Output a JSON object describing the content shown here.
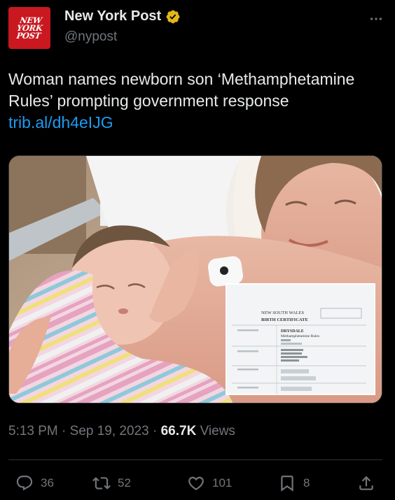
{
  "account": {
    "display_name": "New York Post",
    "handle": "@nypost",
    "logo_text": "NEW YORK POST",
    "verified_icon": "gold-verified-badge",
    "more_icon": "more-options-icon"
  },
  "tweet": {
    "text": "Woman names newborn son ‘Methamphetamine Rules’ prompting government response ",
    "link": "trib.al/dh4eIJG"
  },
  "media": {
    "certificate": {
      "state": "NEW SOUTH WALES",
      "title": "BIRTH CERTIFICATE",
      "surname": "DRYSDALE",
      "given_names": "Methamphetamine Rules"
    }
  },
  "meta": {
    "time": "5:13 PM",
    "separator": " · ",
    "date": "Sep 19, 2023",
    "views_count": "66.7K",
    "views_label": " Views"
  },
  "actions": {
    "replies": "36",
    "reposts": "52",
    "likes": "101",
    "bookmarks": "8"
  },
  "colors": {
    "background": "#000000",
    "text": "#e7e9ea",
    "muted": "#71767b",
    "link": "#1d9bf0",
    "brand": "#c9181f",
    "verified": "#e2b719"
  }
}
